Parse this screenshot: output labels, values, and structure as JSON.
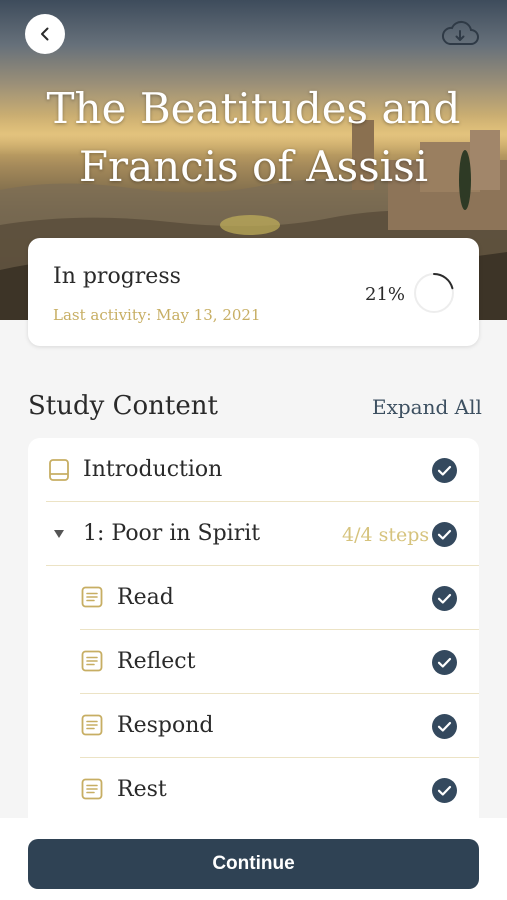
{
  "header": {
    "title_line1": "The Beatitudes and",
    "title_line2": "Francis of Assisi",
    "back_icon": "chevron-left-icon",
    "download_icon": "cloud-download-icon"
  },
  "progress": {
    "status": "In progress",
    "last_activity": "Last activity:  May 13, 2021",
    "percent_label": "21%",
    "percent_value": 0.21
  },
  "study": {
    "title": "Study Content",
    "expand_label": "Expand All",
    "items": [
      {
        "label": "Introduction",
        "icon": "book-icon",
        "completed": true
      },
      {
        "label": "1: Poor in Spirit",
        "icon": "caret-down-icon",
        "steps": "4/4 steps",
        "completed": true
      },
      {
        "label": "Read",
        "icon": "document-icon",
        "completed": true
      },
      {
        "label": "Reflect",
        "icon": "document-icon",
        "completed": true
      },
      {
        "label": "Respond",
        "icon": "document-icon",
        "completed": true
      },
      {
        "label": "Rest",
        "icon": "document-icon",
        "completed": true
      }
    ]
  },
  "footer": {
    "continue_label": "Continue"
  },
  "colors": {
    "accent_gold": "#c7ae63",
    "navy": "#2f4254",
    "check_navy": "#34495e"
  }
}
